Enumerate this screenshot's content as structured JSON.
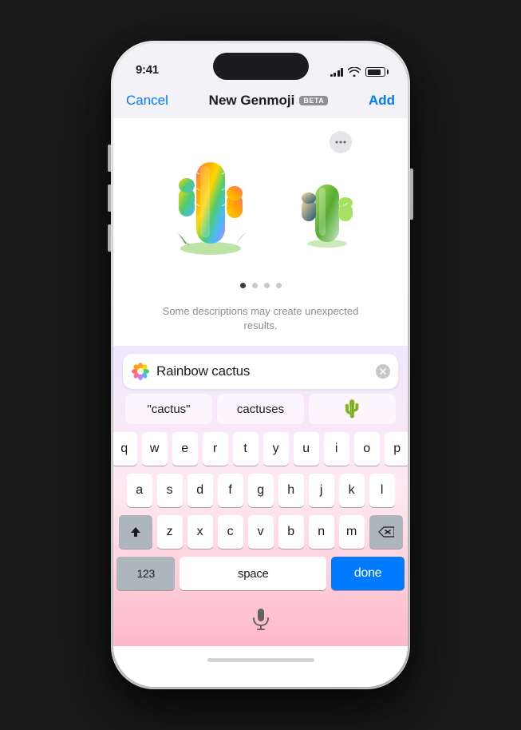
{
  "status": {
    "time": "9:41",
    "battery_level": "80%"
  },
  "header": {
    "cancel_label": "Cancel",
    "title": "New Genmoji",
    "beta_label": "BETA",
    "add_label": "Add"
  },
  "content": {
    "warning_text": "Some descriptions may create unexpected results."
  },
  "search": {
    "value": "Rainbow cactus",
    "genmoji_icon": "genmoji"
  },
  "autocomplete": {
    "items": [
      {
        "label": "\"cactus\"",
        "type": "text"
      },
      {
        "label": "cactuses",
        "type": "text"
      },
      {
        "label": "🌵",
        "type": "emoji"
      }
    ]
  },
  "keyboard": {
    "rows": [
      [
        "q",
        "w",
        "e",
        "r",
        "t",
        "y",
        "u",
        "i",
        "o",
        "p"
      ],
      [
        "a",
        "s",
        "d",
        "f",
        "g",
        "h",
        "j",
        "k",
        "l"
      ],
      [
        "z",
        "x",
        "c",
        "v",
        "b",
        "n",
        "m"
      ]
    ],
    "bottom": {
      "num_label": "123",
      "space_label": "space",
      "done_label": "done"
    }
  },
  "dots": {
    "total": 4,
    "active": 0
  },
  "more_btn_label": "···"
}
